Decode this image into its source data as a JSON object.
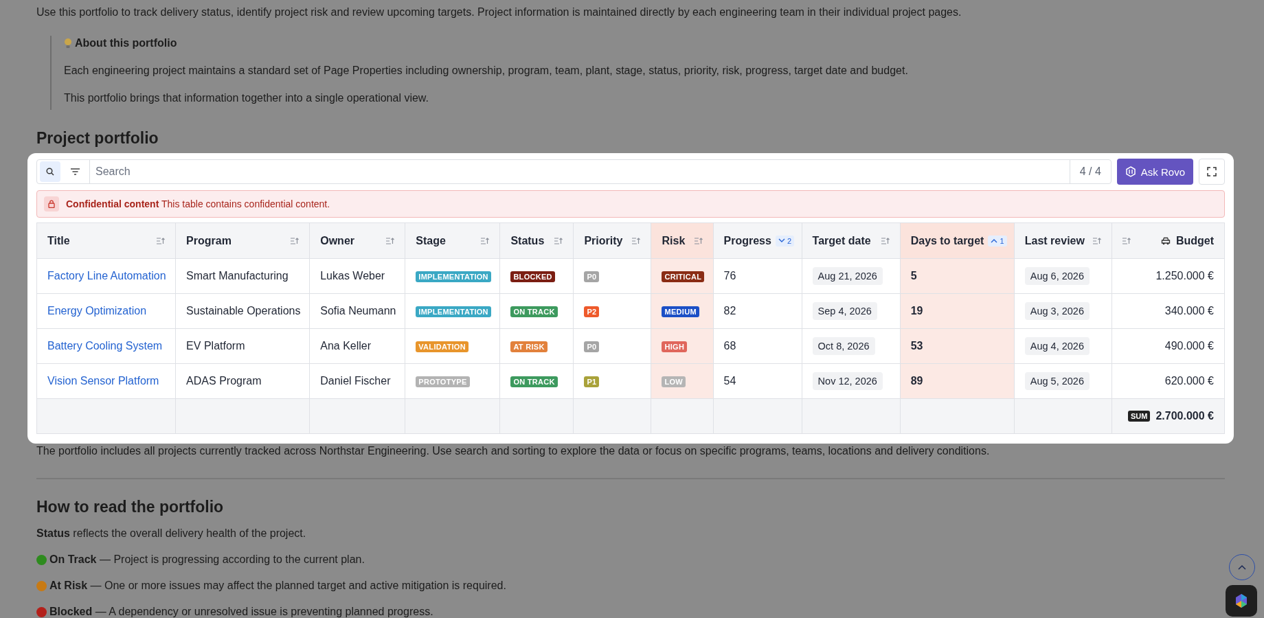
{
  "intro": "Use this portfolio to track delivery status, identify project risk and review upcoming targets. Project information is maintained directly by each engineering team in their individual project pages.",
  "callout": {
    "title": "About this portfolio",
    "paragraphs": [
      "Each engineering project maintains a standard set of Page Properties including ownership, program, team, plant, stage, status, priority, risk, progress, target date and budget.",
      "This portfolio brings that information together into a single operational view."
    ]
  },
  "heading": "Project portfolio",
  "table_card": {
    "tools": [
      {
        "kind": "search",
        "selected": true
      },
      {
        "kind": "filter",
        "selected": false
      }
    ],
    "search": {
      "placeholder": "Search"
    },
    "count": "4 / 4",
    "ask_button": "Ask Rovo",
    "banner": {
      "title": "Confidential content",
      "text": "This table contains confidential content."
    },
    "columns": [
      {
        "label": "Title",
        "highlighted": false,
        "sorted": false
      },
      {
        "label": "Program",
        "highlighted": false,
        "sorted": false
      },
      {
        "label": "Owner",
        "highlighted": false,
        "sorted": false
      },
      {
        "label": "Stage",
        "highlighted": false,
        "sorted": false
      },
      {
        "label": "Status",
        "highlighted": false,
        "sorted": false
      },
      {
        "label": "Priority",
        "highlighted": false,
        "sorted": false
      },
      {
        "label": "Risk",
        "highlighted": true,
        "sorted": false
      },
      {
        "label": "Progress",
        "highlighted": false,
        "sorted": true,
        "ascending": false,
        "sort_rank": "2"
      },
      {
        "label": "Target date",
        "highlighted": false,
        "sorted": false
      },
      {
        "label": "Days to target",
        "highlighted": true,
        "sorted": true,
        "ascending": true,
        "sort_rank": "1"
      },
      {
        "label": "Last review",
        "highlighted": false,
        "sorted": false
      },
      {
        "label": "Budget",
        "highlighted": false,
        "sorted": false
      }
    ],
    "rows": [
      {
        "title": "Factory Line Automation",
        "program": "Smart Manufacturing",
        "owner": "Lukas Weber",
        "stage": {
          "label": "IMPLEMENTATION",
          "color": "#3aa8c4"
        },
        "status": {
          "label": "BLOCKED",
          "color": "#7b1e12"
        },
        "priority": {
          "label": "P0",
          "color": "#a5a5a5"
        },
        "risk": {
          "label": "CRITICAL",
          "color": "#8a2c14"
        },
        "progress": "76",
        "target_date": "Aug 21, 2026",
        "days": "5",
        "last_review": "Aug 6, 2026",
        "budget": "1.250.000 €"
      },
      {
        "title": "Energy Optimization",
        "program": "Sustainable Operations",
        "owner": "Sofia Neumann",
        "stage": {
          "label": "IMPLEMENTATION",
          "color": "#3aa8c4"
        },
        "status": {
          "label": "ON TRACK",
          "color": "#3d9a5e"
        },
        "priority": {
          "label": "P2",
          "color": "#ee5a2b"
        },
        "risk": {
          "label": "MEDIUM",
          "color": "#1b4fc6"
        },
        "progress": "82",
        "target_date": "Sep 4, 2026",
        "days": "19",
        "last_review": "Aug 3, 2026",
        "budget": "340.000 €"
      },
      {
        "title": "Battery Cooling System",
        "program": "EV Platform",
        "owner": "Ana Keller",
        "stage": {
          "label": "VALIDATION",
          "color": "#e8952c"
        },
        "status": {
          "label": "AT RISK",
          "color": "#e2813c"
        },
        "priority": {
          "label": "P0",
          "color": "#a5a5a5"
        },
        "risk": {
          "label": "HIGH",
          "color": "#e0665c"
        },
        "progress": "68",
        "target_date": "Oct 8, 2026",
        "days": "53",
        "last_review": "Aug 4, 2026",
        "budget": "490.000 €"
      },
      {
        "title": "Vision Sensor Platform",
        "program": "ADAS Program",
        "owner": "Daniel Fischer",
        "stage": {
          "label": "PROTOTYPE",
          "color": "#b3b3b3"
        },
        "status": {
          "label": "ON TRACK",
          "color": "#3d9a5e"
        },
        "priority": {
          "label": "P1",
          "color": "#a9a23a"
        },
        "risk": {
          "label": "LOW",
          "color": "#b5b5b5"
        },
        "progress": "54",
        "target_date": "Nov 12, 2026",
        "days": "89",
        "last_review": "Aug 5, 2026",
        "budget": "620.000 €"
      }
    ],
    "footer": {
      "badge": "SUM",
      "total": "2.700.000 €"
    }
  },
  "after_table": "The portfolio includes all projects currently tracked across Northstar Engineering. Use search and sorting to explore the data or focus on specific programs, teams, locations and delivery conditions.",
  "heading2": "How to read the portfolio",
  "status_intro": "**Status** reflects the overall delivery health of the project.",
  "legend": [
    {
      "color": "#2e8b1e",
      "label": "On Track",
      "text": "— Project is progressing according to the current plan."
    },
    {
      "color": "#c77a14",
      "label": "At Risk",
      "text": "— One or more issues may affect the planned target and active mitigation is required."
    },
    {
      "color": "#b3201a",
      "label": "Blocked",
      "text": "— A dependency or unresolved issue is preventing planned progress."
    }
  ]
}
